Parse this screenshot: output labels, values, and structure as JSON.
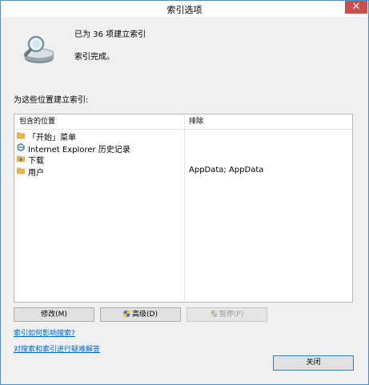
{
  "window": {
    "title": "索引选项",
    "close_glyph": "✕"
  },
  "status": {
    "count_text": "已为 36 项建立索引",
    "complete_text": "索引完成。"
  },
  "locations": {
    "section_label": "为这些位置建立索引:",
    "headers": {
      "included": "包含的位置",
      "excluded": "排除"
    },
    "rows": [
      {
        "name": "「开始」菜单",
        "exclude": "",
        "icon": "folder-icon"
      },
      {
        "name": "Internet Explorer 历史记录",
        "exclude": "",
        "icon": "ie-icon"
      },
      {
        "name": "下载",
        "exclude": "",
        "icon": "download-folder-icon"
      },
      {
        "name": "用户",
        "exclude": "AppData; AppData",
        "icon": "folder-icon"
      }
    ]
  },
  "buttons": {
    "modify": "修改(M)",
    "advanced": "高级(D)",
    "pause": "暂停(P)",
    "close": "关闭"
  },
  "links": {
    "how_indexing": "索引如何影响搜索?",
    "troubleshoot": "对搜索和索引进行疑难解答"
  },
  "colors": {
    "link": "#0066cc",
    "close_button": "#c7514a",
    "window_border": "#4d90c8"
  }
}
